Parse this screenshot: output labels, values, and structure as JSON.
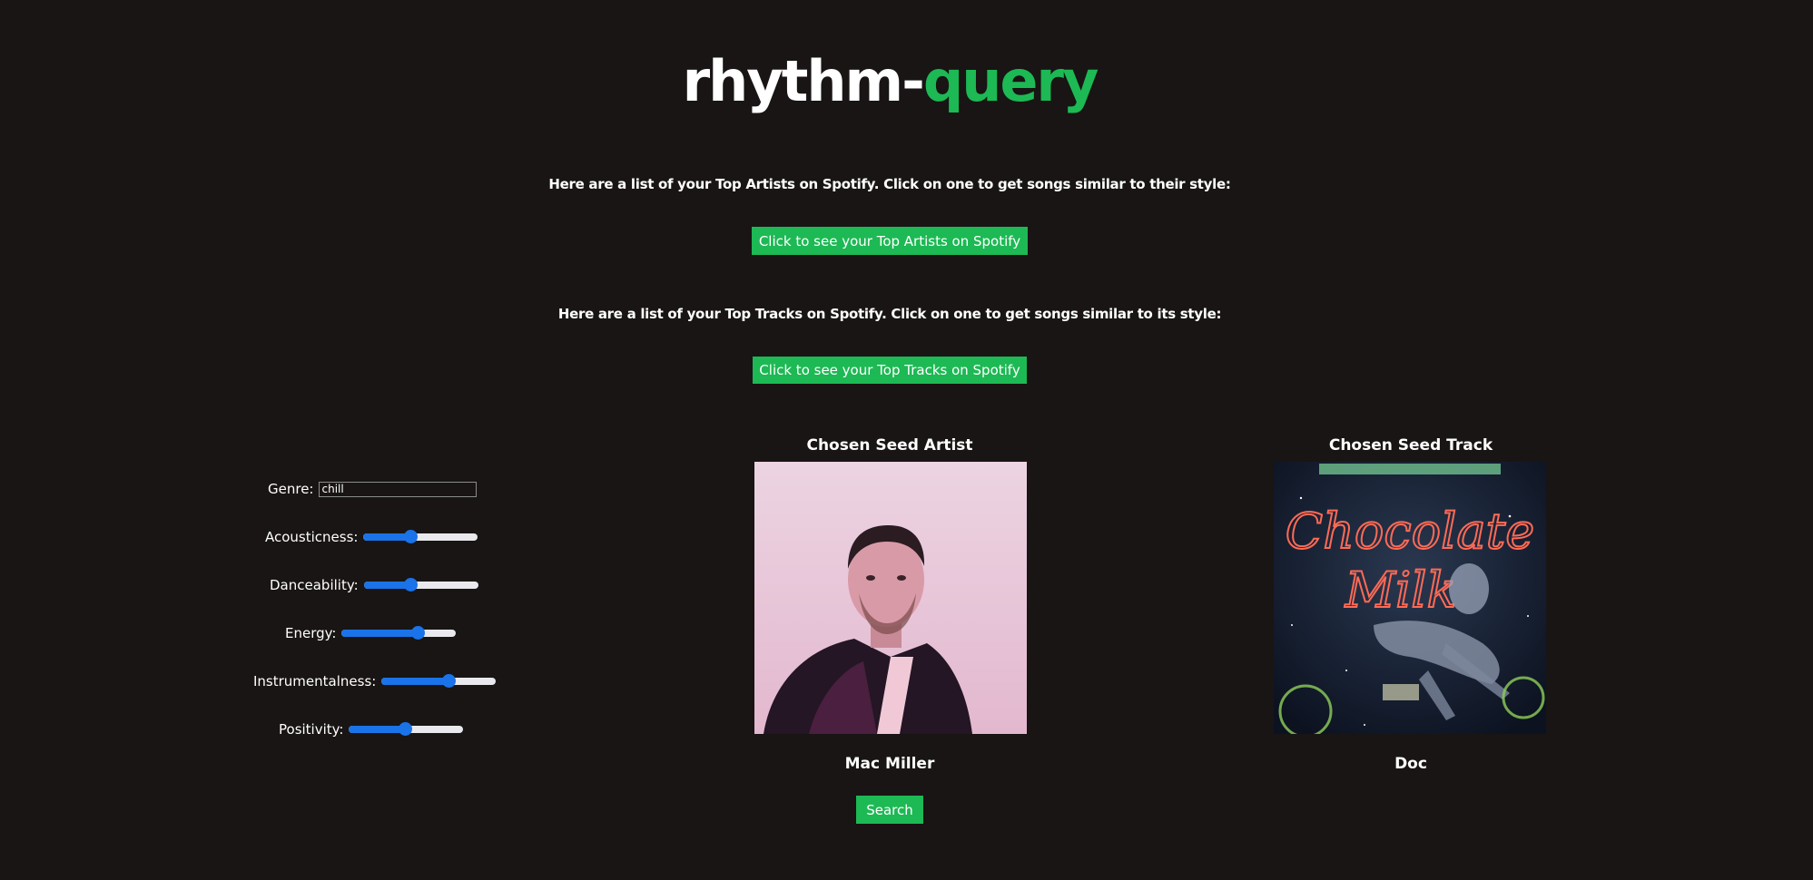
{
  "header": {
    "title_main": "rhythm-",
    "title_accent": "query"
  },
  "top_artists": {
    "info": "Here are a list of your Top Artists on Spotify. Click on one to get songs similar to their style:",
    "button_label": "Click to see your Top Artists on Spotify"
  },
  "top_tracks": {
    "info": "Here are a list of your Top Tracks on Spotify. Click on one to get songs similar to its style:",
    "button_label": "Click to see your Top Tracks on Spotify"
  },
  "filters": {
    "genre_label": "Genre:",
    "genre_value": "chill",
    "sliders": [
      {
        "label": "Acousticness:",
        "value": 0.41
      },
      {
        "label": "Danceability:",
        "value": 0.41
      },
      {
        "label": "Energy:",
        "value": 0.67
      },
      {
        "label": "Instrumentalness:",
        "value": 0.59
      },
      {
        "label": "Positivity:",
        "value": 0.49
      }
    ]
  },
  "seed_artist": {
    "heading": "Chosen Seed Artist",
    "name": "Mac Miller"
  },
  "seed_track": {
    "heading": "Chosen Seed Track",
    "name": "Doc",
    "cover_text_1": "Chocolate",
    "cover_text_2": "Milk"
  },
  "search": {
    "button_label": "Search"
  },
  "colors": {
    "accent": "#1db954",
    "background": "#181514",
    "slider": "#1a73e8"
  }
}
